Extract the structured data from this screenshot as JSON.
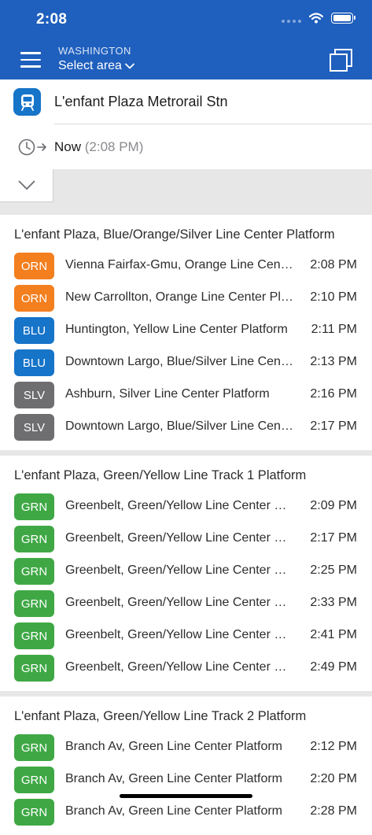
{
  "status": {
    "time": "2:08"
  },
  "header": {
    "region": "WASHINGTON",
    "area_select": "Select area"
  },
  "search": {
    "station": "L'enfant Plaza Metrorail Stn",
    "time_label": "Now",
    "time_value": "(2:08 PM)"
  },
  "colors": {
    "header": "#1f5fbd",
    "ORN": "#f37f1f",
    "BLU": "#1674c9",
    "SLV": "#6e6e70",
    "GRN": "#3fa845"
  },
  "sections": [
    {
      "title": "L'enfant Plaza, Blue/Orange/Silver Line Center Platform",
      "rows": [
        {
          "line": "ORN",
          "destination": "Vienna Fairfax-Gmu, Orange Line Center Platform",
          "time": "2:08 PM"
        },
        {
          "line": "ORN",
          "destination": "New Carrollton, Orange Line Center Platform",
          "time": "2:10 PM"
        },
        {
          "line": "BLU",
          "destination": "Huntington, Yellow Line Center Platform",
          "time": "2:11 PM"
        },
        {
          "line": "BLU",
          "destination": "Downtown Largo, Blue/Silver Line Center Platform",
          "time": "2:13 PM"
        },
        {
          "line": "SLV",
          "destination": "Ashburn, Silver Line Center Platform",
          "time": "2:16 PM"
        },
        {
          "line": "SLV",
          "destination": "Downtown Largo, Blue/Silver Line Center Platform",
          "time": "2:17 PM"
        }
      ]
    },
    {
      "title": "L'enfant Plaza, Green/Yellow Line Track 1 Platform",
      "rows": [
        {
          "line": "GRN",
          "destination": "Greenbelt, Green/Yellow Line Center Platform",
          "time": "2:09 PM"
        },
        {
          "line": "GRN",
          "destination": "Greenbelt, Green/Yellow Line Center Platform",
          "time": "2:17 PM"
        },
        {
          "line": "GRN",
          "destination": "Greenbelt, Green/Yellow Line Center Platform",
          "time": "2:25 PM"
        },
        {
          "line": "GRN",
          "destination": "Greenbelt, Green/Yellow Line Center Platform",
          "time": "2:33 PM"
        },
        {
          "line": "GRN",
          "destination": "Greenbelt, Green/Yellow Line Center Platform",
          "time": "2:41 PM"
        },
        {
          "line": "GRN",
          "destination": "Greenbelt, Green/Yellow Line Center Platform",
          "time": "2:49 PM"
        }
      ]
    },
    {
      "title": "L'enfant Plaza, Green/Yellow Line Track 2 Platform",
      "rows": [
        {
          "line": "GRN",
          "destination": "Branch Av, Green Line Center Platform",
          "time": "2:12 PM"
        },
        {
          "line": "GRN",
          "destination": "Branch Av, Green Line Center Platform",
          "time": "2:20 PM"
        },
        {
          "line": "GRN",
          "destination": "Branch Av, Green Line Center Platform",
          "time": "2:28 PM"
        }
      ]
    }
  ]
}
